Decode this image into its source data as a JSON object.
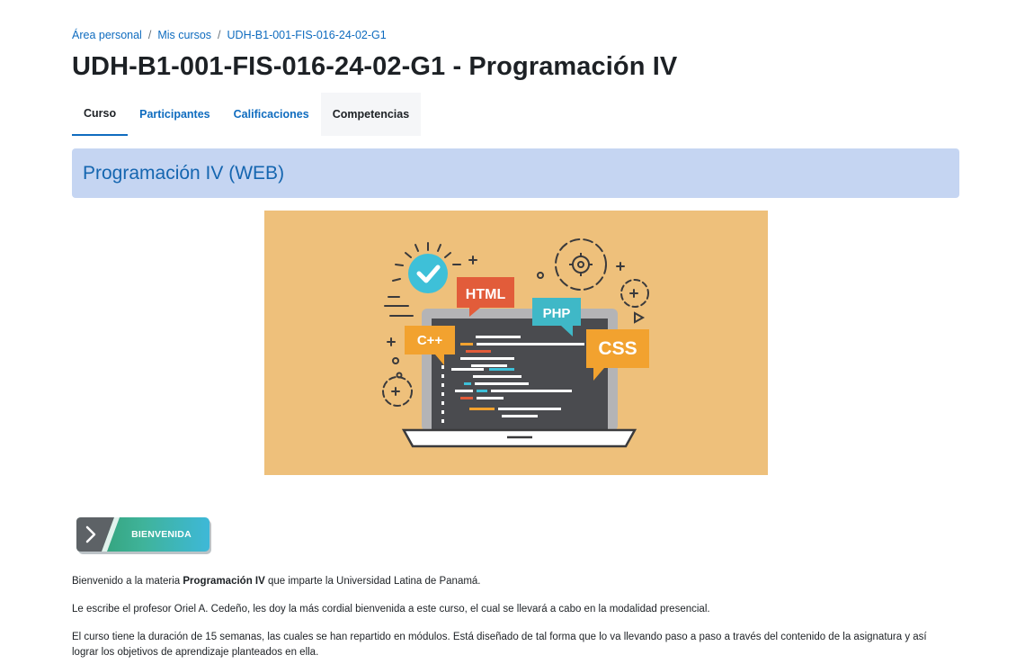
{
  "breadcrumb": {
    "items": [
      "Área personal",
      "Mis cursos",
      "UDH-B1-001-FIS-016-24-02-G1"
    ],
    "separator": "/"
  },
  "page_title": "UDH-B1-001-FIS-016-24-02-G1 - Programación IV",
  "tabs": [
    {
      "label": "Curso",
      "active": true
    },
    {
      "label": "Participantes",
      "active": false
    },
    {
      "label": "Calificaciones",
      "active": false
    },
    {
      "label": "Competencias",
      "active": false
    }
  ],
  "section": {
    "title": "Programación IV (WEB)"
  },
  "banner": {
    "labels": {
      "html": "HTML",
      "php": "PHP",
      "cpp": "C++",
      "css": "CSS"
    },
    "colors": {
      "background": "#eec07b",
      "html": "#e25c3a",
      "php": "#3fb8c7",
      "cpp": "#f2a22f",
      "css": "#f2a22f",
      "screen": "#4a4b4f",
      "check": "#3ec0d8"
    }
  },
  "welcome_button": {
    "label": "BIENVENIDA",
    "icon": "chevron-right-icon"
  },
  "content": {
    "p1": {
      "before": "Bienvenido a la materia ",
      "bold": "Programación IV",
      "after": " que imparte la Universidad Latina de Panamá."
    },
    "p2": "Le escribe el  profesor Oriel A. Cedeño, les doy la más cordial bienvenida a este curso, el cual se llevará a cabo en la modalidad presencial.",
    "p3": "El curso tiene la duración de 15 semanas, las cuales se han repartido en módulos. Está diseñado de tal forma que lo va llevando paso a paso a través del contenido de la asignatura y así lograr los objetivos de aprendizaje planteados en ella."
  },
  "colors": {
    "link": "#0f6cbf",
    "section_bg": "#c5d5f2",
    "section_title": "#1566b0"
  }
}
